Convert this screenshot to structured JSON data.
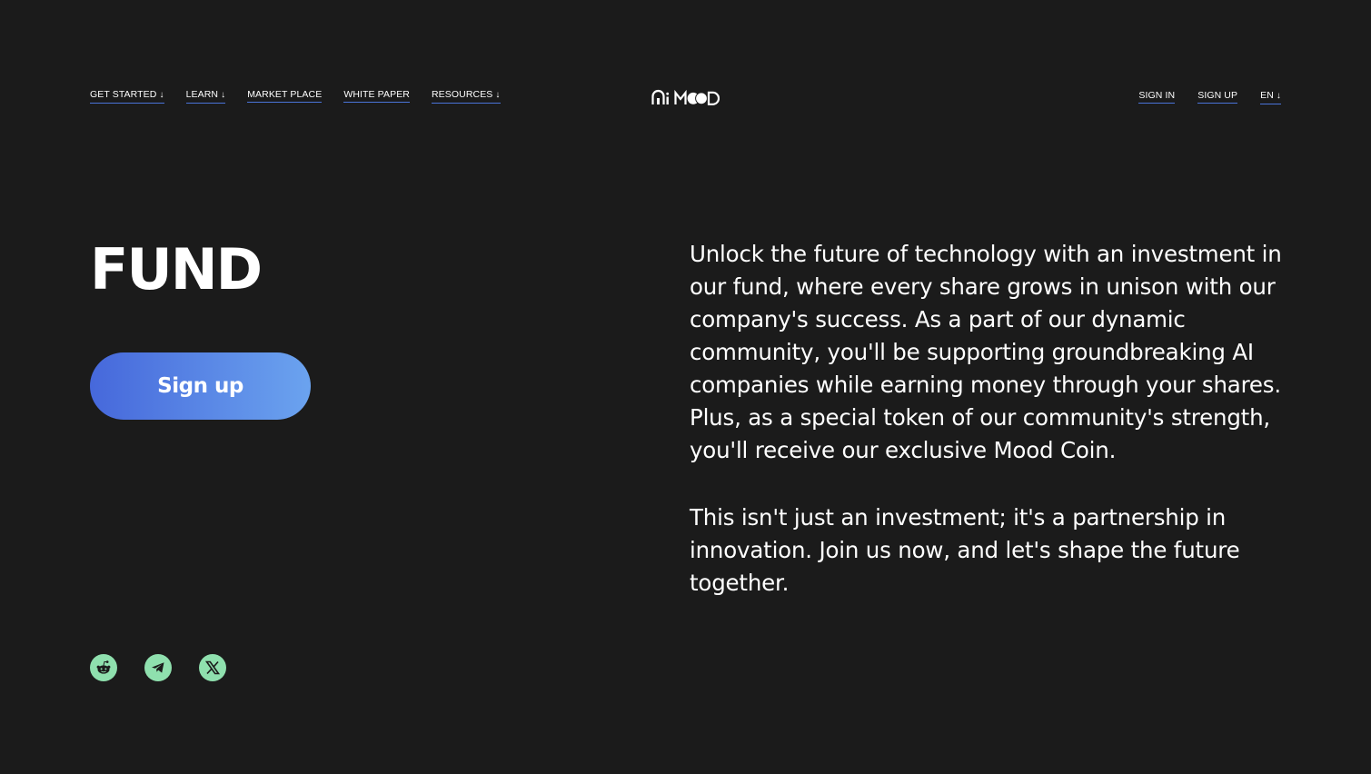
{
  "header": {
    "nav_left": [
      {
        "label": "GET STARTED",
        "has_dropdown": true
      },
      {
        "label": "LEARN",
        "has_dropdown": true
      },
      {
        "label": "MARKET PLACE",
        "has_dropdown": false
      },
      {
        "label": "WHITE PAPER",
        "has_dropdown": false
      },
      {
        "label": "RESOURCES",
        "has_dropdown": true
      }
    ],
    "dropdown_arrow": "↓",
    "logo_alt": "Ai MOOD",
    "nav_right": [
      {
        "label": "SIGN IN"
      },
      {
        "label": "SIGN UP"
      },
      {
        "label": "EN",
        "has_dropdown": true
      }
    ]
  },
  "hero": {
    "title": "FUND",
    "cta_label": "Sign up",
    "paragraphs": [
      "Unlock the future of technology with an investment in our fund, where every share grows in unison with our company's success. As a part of our dynamic community, you'll be supporting groundbreaking AI companies while earning money through your shares. Plus, as a special token of our community's strength, you'll receive our exclusive Mood Coin.",
      "This isn't just an investment; it's a partnership in innovation. Join us now, and let's shape the future together."
    ]
  },
  "social": [
    {
      "icon": "reddit-icon"
    },
    {
      "icon": "telegram-icon"
    },
    {
      "icon": "x-icon"
    }
  ],
  "colors": {
    "background": "#1b1b1b",
    "accent_underline": "#4a74d9",
    "button_gradient_start": "#4668db",
    "button_gradient_end": "#6ba3ef",
    "social_bg": "#8fe0ae"
  }
}
